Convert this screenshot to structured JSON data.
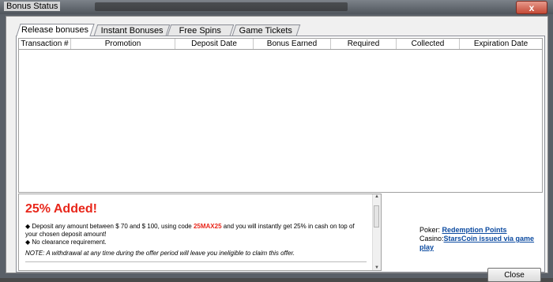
{
  "window": {
    "title": "Bonus Status",
    "close_glyph": "x"
  },
  "tabs": [
    {
      "label": "Release bonuses",
      "active": true
    },
    {
      "label": "Instant Bonuses",
      "active": false
    },
    {
      "label": "Free Spins",
      "active": false
    },
    {
      "label": "Game Tickets",
      "active": false
    }
  ],
  "table": {
    "columns": [
      "Transaction #",
      "Promotion",
      "Deposit Date",
      "Bonus Earned",
      "Required",
      "Collected",
      "Expiration Date"
    ],
    "rows": []
  },
  "promo": {
    "title": "25% Added!",
    "bullet1_before": "Deposit any amount between $ 70 and $ 100, using code ",
    "code": "25MAX25",
    "bullet1_after": " and you will instantly get 25% in cash on top of your chosen deposit amount!",
    "bullet2": "No clearance requirement.",
    "note": "NOTE: A withdrawal at any time during the offer period will leave you ineligible to claim this offer."
  },
  "info": {
    "poker_label": "Poker:",
    "poker_link": "Redemption Points",
    "casino_label": "Casino:",
    "casino_link": "StarsCoin issued via game play"
  },
  "buttons": {
    "close": "Close"
  },
  "colors": {
    "accent_red": "#e8261a",
    "link_blue": "#0b4aa0"
  }
}
